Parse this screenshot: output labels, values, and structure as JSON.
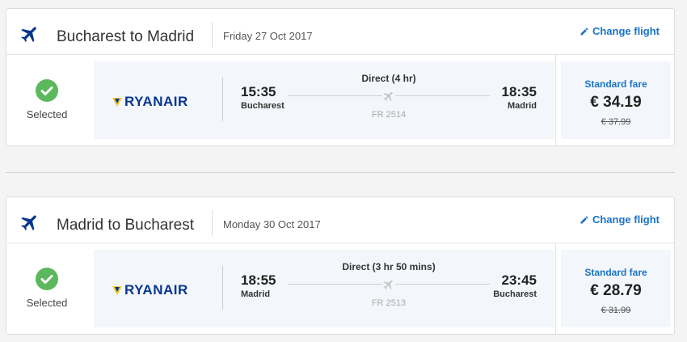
{
  "colors": {
    "brand_blue": "#1a73c8",
    "ryanair_blue": "#073590",
    "ryanair_yellow": "#f1c933",
    "selected_green": "#5cb85c",
    "panel_bg": "#f3f7fb"
  },
  "flights": [
    {
      "route": "Bucharest to Madrid",
      "date": "Friday 27 Oct 2017",
      "change_label": "Change flight",
      "selected_label": "Selected",
      "airline": "RYANAIR",
      "dep_time": "15:35",
      "dep_city": "Bucharest",
      "duration": "Direct (4 hr)",
      "flight_number": "FR 2514",
      "arr_time": "18:35",
      "arr_city": "Madrid",
      "fare_label": "Standard fare",
      "price": "€ 34.19",
      "old_price": "€ 37.99",
      "icons": {
        "header": "plane-icon",
        "edit": "pencil-icon",
        "status": "check-circle-icon"
      }
    },
    {
      "route": "Madrid to Bucharest",
      "date": "Monday 30 Oct 2017",
      "change_label": "Change flight",
      "selected_label": "Selected",
      "airline": "RYANAIR",
      "dep_time": "18:55",
      "dep_city": "Madrid",
      "duration": "Direct (3 hr 50 mins)",
      "flight_number": "FR 2513",
      "arr_time": "23:45",
      "arr_city": "Bucharest",
      "fare_label": "Standard fare",
      "price": "€ 28.79",
      "old_price": "€ 31.99",
      "icons": {
        "header": "plane-icon",
        "edit": "pencil-icon",
        "status": "check-circle-icon"
      }
    }
  ]
}
